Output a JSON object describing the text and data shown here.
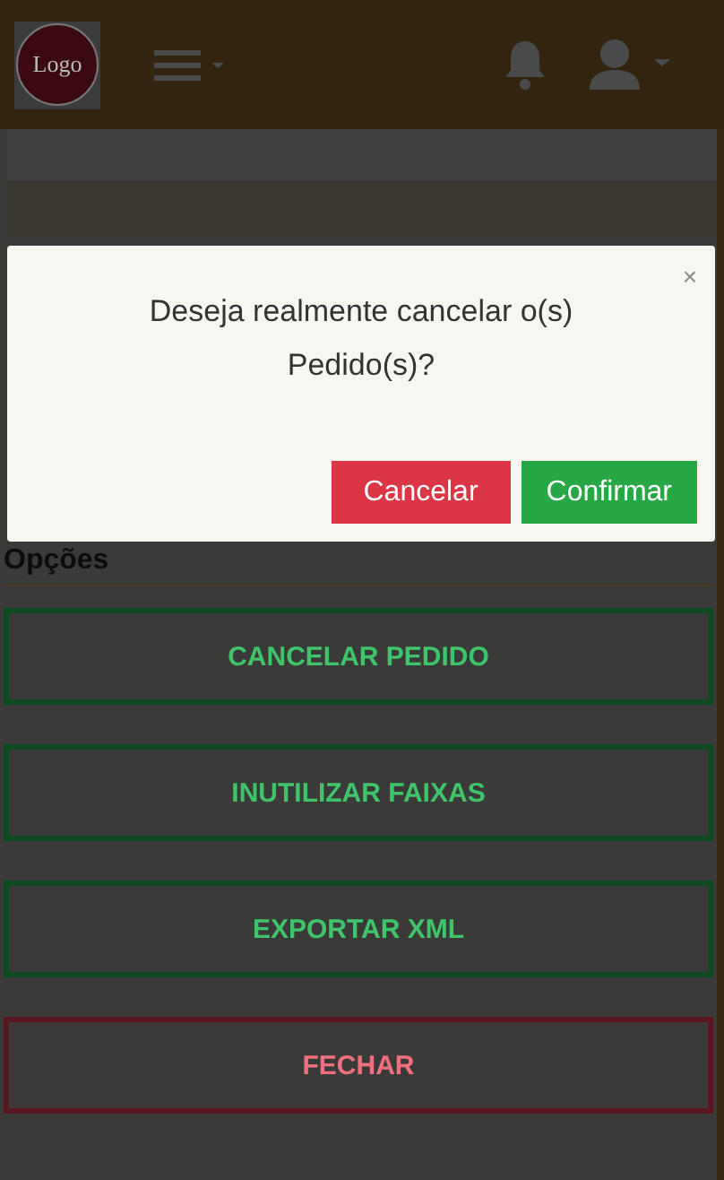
{
  "header": {
    "logo_text": "Logo"
  },
  "modal": {
    "message": "Deseja realmente cancelar o(s) Pedido(s)?",
    "close": "×",
    "buttons": [
      {
        "label": "Cancelar",
        "kind": "danger"
      },
      {
        "label": "Confirmar",
        "kind": "success"
      }
    ]
  },
  "section_title": "Opções",
  "options": [
    {
      "label": "CANCELAR PEDIDO",
      "kind": "success"
    },
    {
      "label": "INUTILIZAR FAIXAS",
      "kind": "success"
    },
    {
      "label": "EXPORTAR XML",
      "kind": "success"
    },
    {
      "label": "FECHAR",
      "kind": "danger"
    }
  ]
}
